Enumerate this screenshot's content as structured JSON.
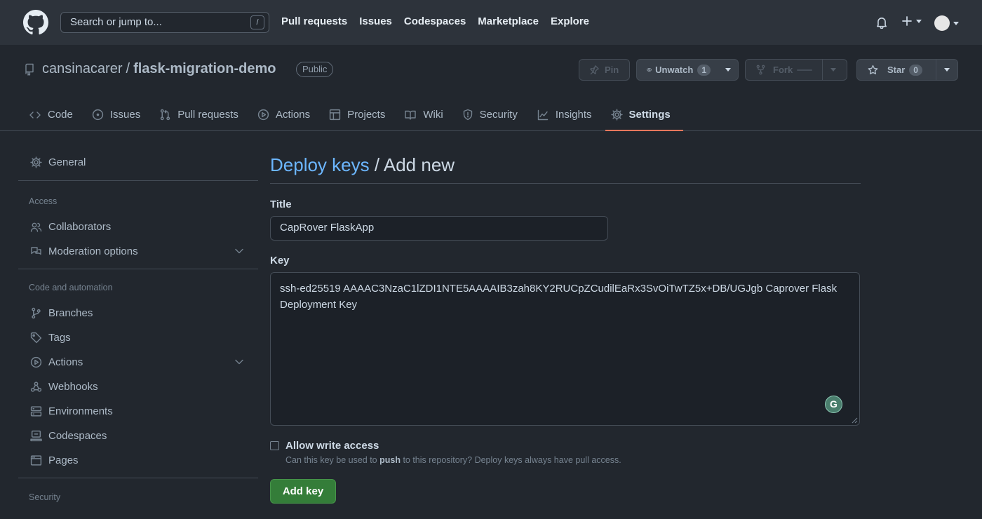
{
  "header": {
    "search_placeholder": "Search or jump to...",
    "search_shortcut": "/",
    "nav": [
      "Pull requests",
      "Issues",
      "Codespaces",
      "Marketplace",
      "Explore"
    ]
  },
  "repo": {
    "owner": "cansinacarer",
    "separator": "/",
    "name": "flask-migration-demo",
    "visibility": "Public",
    "pin_label": "Pin",
    "watch_label": "Unwatch",
    "watch_count": "1",
    "fork_label": "Fork",
    "star_label": "Star",
    "star_count": "0"
  },
  "tabs": [
    {
      "label": "Code",
      "icon": "code-icon"
    },
    {
      "label": "Issues",
      "icon": "issue-icon"
    },
    {
      "label": "Pull requests",
      "icon": "pull-request-icon"
    },
    {
      "label": "Actions",
      "icon": "play-icon"
    },
    {
      "label": "Projects",
      "icon": "table-icon"
    },
    {
      "label": "Wiki",
      "icon": "book-icon"
    },
    {
      "label": "Security",
      "icon": "shield-icon"
    },
    {
      "label": "Insights",
      "icon": "graph-icon"
    },
    {
      "label": "Settings",
      "icon": "gear-icon",
      "active": true
    }
  ],
  "sidebar": {
    "general": "General",
    "access_heading": "Access",
    "collaborators": "Collaborators",
    "moderation": "Moderation options",
    "code_heading": "Code and automation",
    "branches": "Branches",
    "tags": "Tags",
    "actions": "Actions",
    "webhooks": "Webhooks",
    "environments": "Environments",
    "codespaces": "Codespaces",
    "pages": "Pages",
    "security_heading": "Security"
  },
  "form": {
    "breadcrumb_link": "Deploy keys",
    "breadcrumb_sep": " / ",
    "breadcrumb_current": "Add new",
    "title_label": "Title",
    "title_value": "CapRover FlaskApp",
    "key_label": "Key",
    "key_value": "ssh-ed25519 AAAAC3NzaC1lZDI1NTE5AAAAIB3zah8KY2RUCpZCudilEaRx3SvOiTwTZ5x+DB/UGJgb Caprover Flask Deployment Key",
    "grammarly_letter": "G",
    "write_access_label": "Allow write access",
    "hint_before": "Can this key be used to ",
    "hint_bold": "push",
    "hint_after": " to this repository? Deploy keys always have pull access.",
    "submit_label": "Add key"
  },
  "colors": {
    "background": "#22272e",
    "header": "#2d333b",
    "accent_link": "#6cb6ff",
    "primary_button": "#347d39",
    "active_tab_underline": "#ec775c"
  }
}
